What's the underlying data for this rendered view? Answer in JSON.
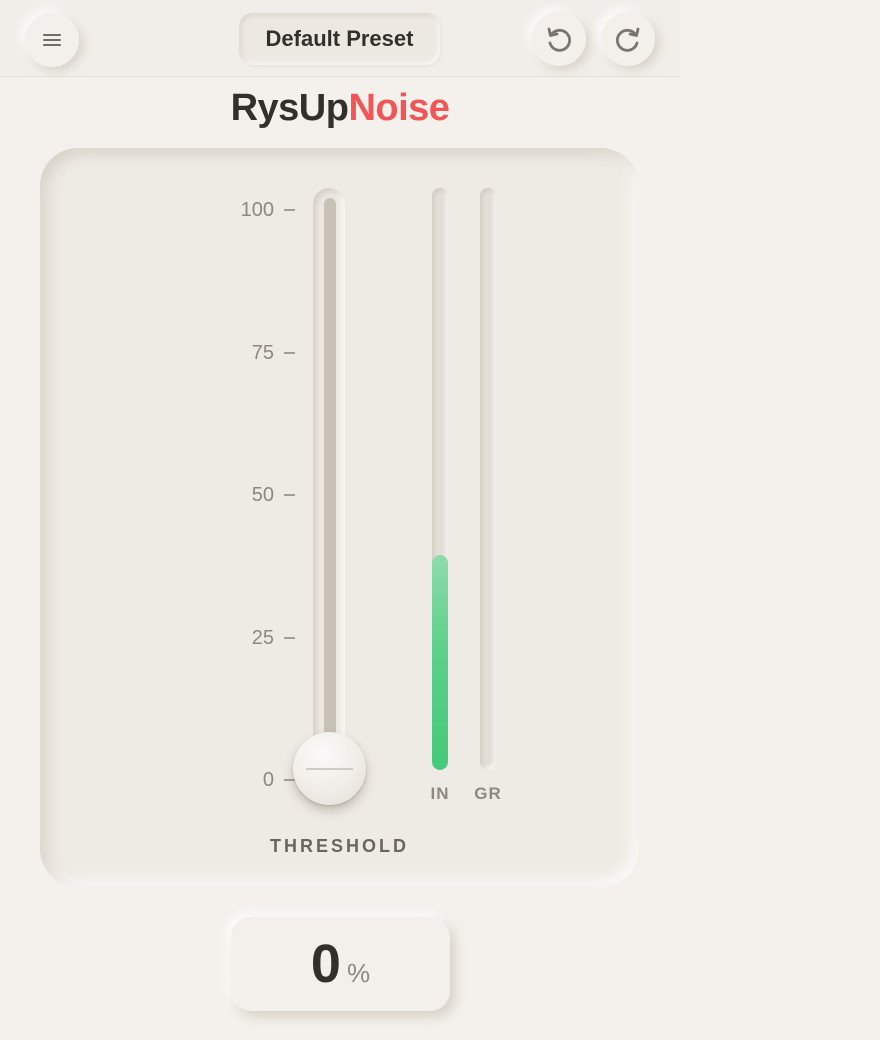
{
  "topbar": {
    "menu_icon": "hamburger-icon",
    "preset_label": "Default Preset",
    "undo_icon": "undo-icon",
    "redo_icon": "redo-icon"
  },
  "logo": {
    "part1": "RysUp",
    "part2": "Noise",
    "part1_color": "#33302c",
    "part2_color": "#f25555"
  },
  "scale": {
    "ticks": [
      "100",
      "75",
      "50",
      "25",
      "0"
    ]
  },
  "threshold": {
    "label": "THRESHOLD",
    "value_fraction": 0.0
  },
  "meters": {
    "in_label": "IN",
    "gr_label": "GR",
    "in_level": 0.37,
    "gr_level": 0.0,
    "in_color": "#45c97a"
  },
  "readout": {
    "value": "0",
    "unit": "%"
  }
}
